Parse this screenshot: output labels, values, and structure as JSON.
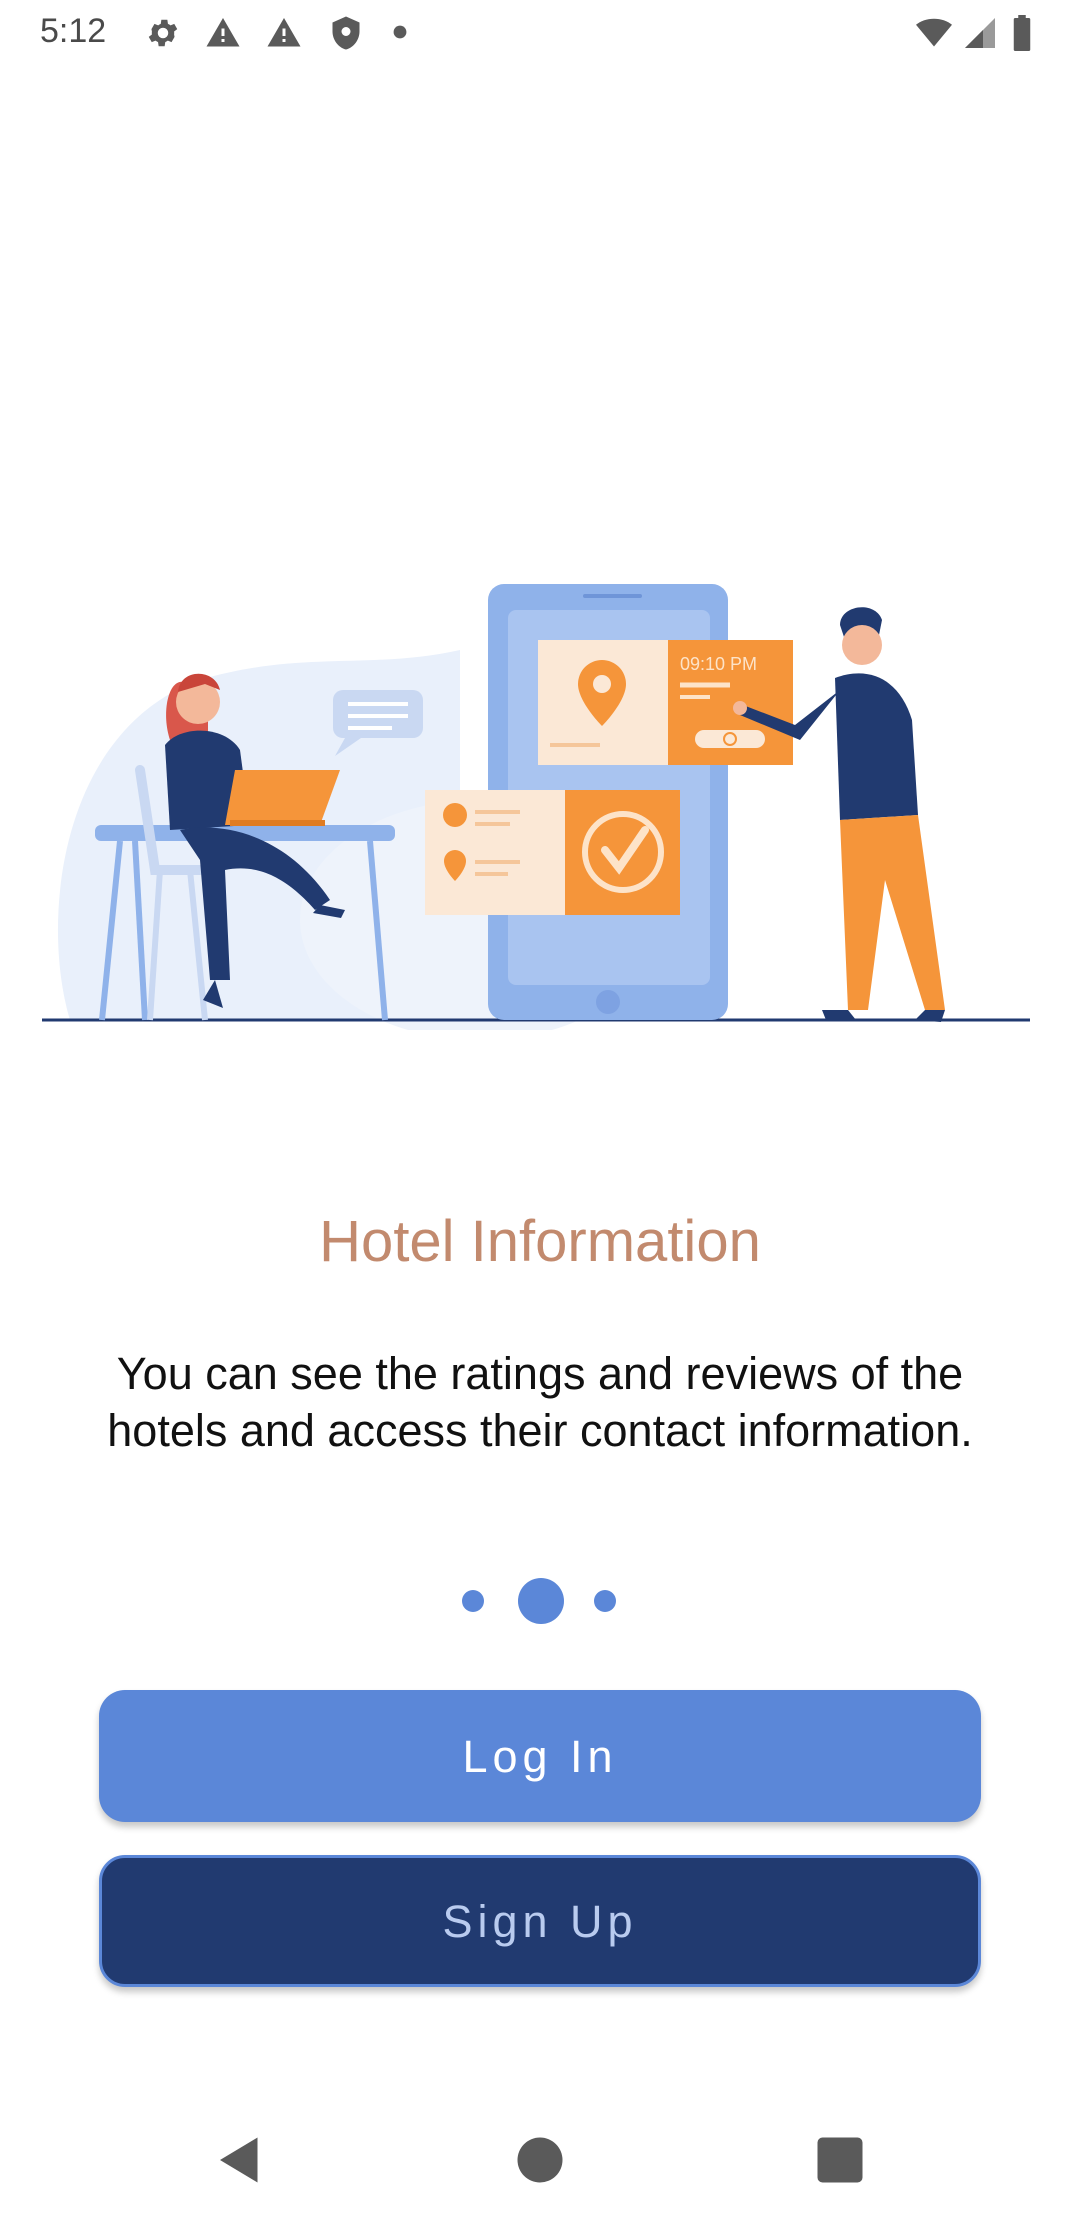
{
  "status_bar": {
    "time": "5:12",
    "left_icons": [
      "settings-gear-icon",
      "alert-icon",
      "alert-icon",
      "shield-icon",
      "dot-icon"
    ],
    "right_icons": [
      "wifi-icon",
      "cell-signal-icon",
      "battery-icon"
    ]
  },
  "illustration": {
    "phone_time": "09:10 PM",
    "description_icon": "hotel-booking-illustration"
  },
  "onboarding": {
    "title": "Hotel Information",
    "description": "You can see the ratings and reviews of the hotels and access their contact information.",
    "page_count": 3,
    "current_page_index": 1
  },
  "buttons": {
    "login_label": "Log In",
    "signup_label": "Sign Up"
  },
  "colors": {
    "title": "#c28a6e",
    "primary": "#5b87d8",
    "dark_primary": "#213a70",
    "accent_orange": "#f5953a"
  },
  "nav_bar": {
    "icons": [
      "back-icon",
      "home-icon",
      "recents-icon"
    ]
  }
}
